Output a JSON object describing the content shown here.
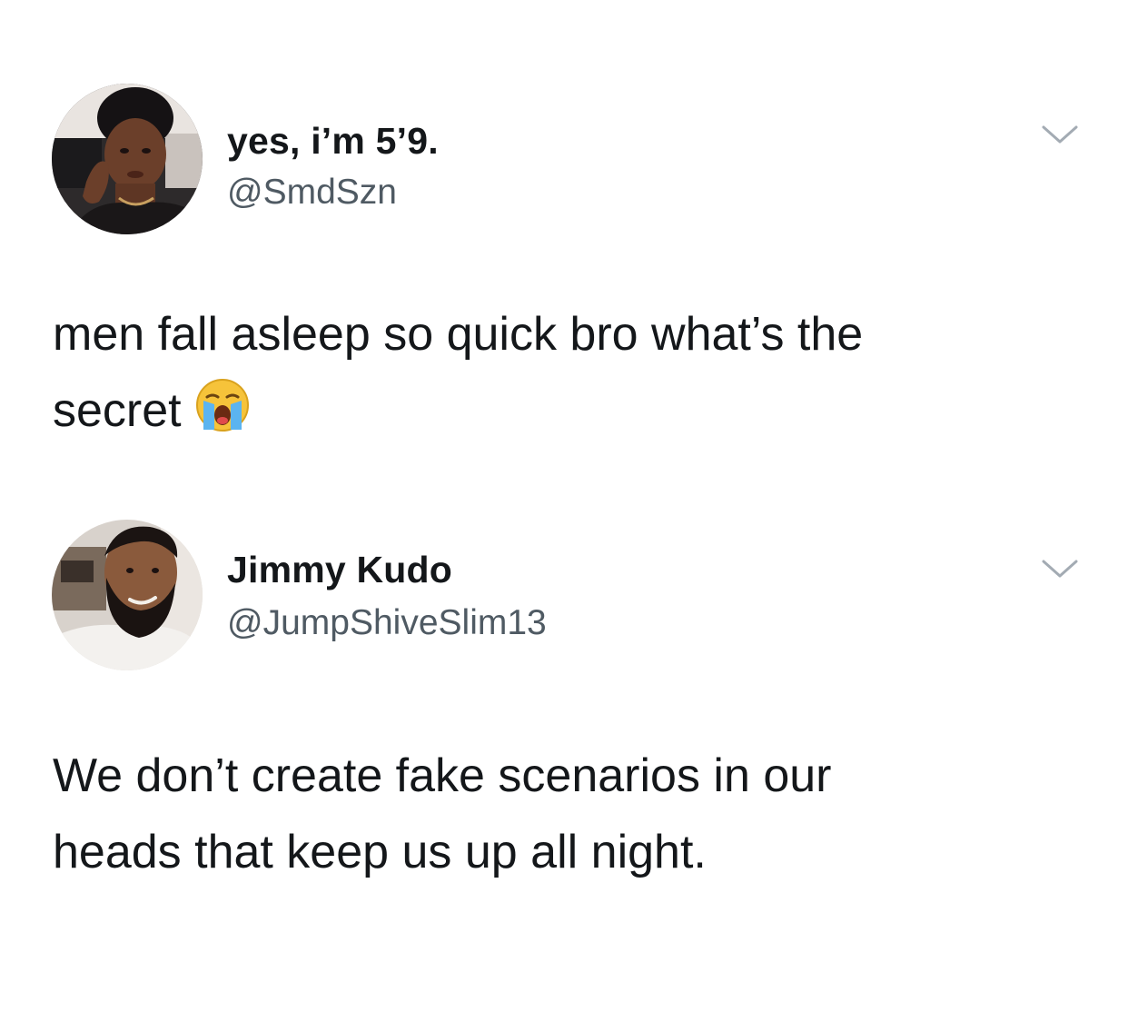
{
  "tweets": [
    {
      "display_name": "yes, i’m 5’9.",
      "handle": "@SmdSzn",
      "avatar_icon": "profile-photo-woman",
      "menu_icon": "chevron-down-icon",
      "body_lines": [
        "men fall asleep so quick bro what’s the",
        "secret"
      ],
      "emoji": "loudly-crying-face-icon"
    },
    {
      "display_name": "Jimmy Kudo",
      "handle": "@JumpShiveSlim13",
      "avatar_icon": "profile-photo-man",
      "menu_icon": "chevron-down-icon",
      "body_lines": [
        "We don’t create fake scenarios in our",
        "heads that keep us up all night."
      ]
    }
  ],
  "colors": {
    "text": "#14171a",
    "handle": "#4f5a63",
    "chevron": "#a3abb3",
    "background": "#ffffff"
  }
}
